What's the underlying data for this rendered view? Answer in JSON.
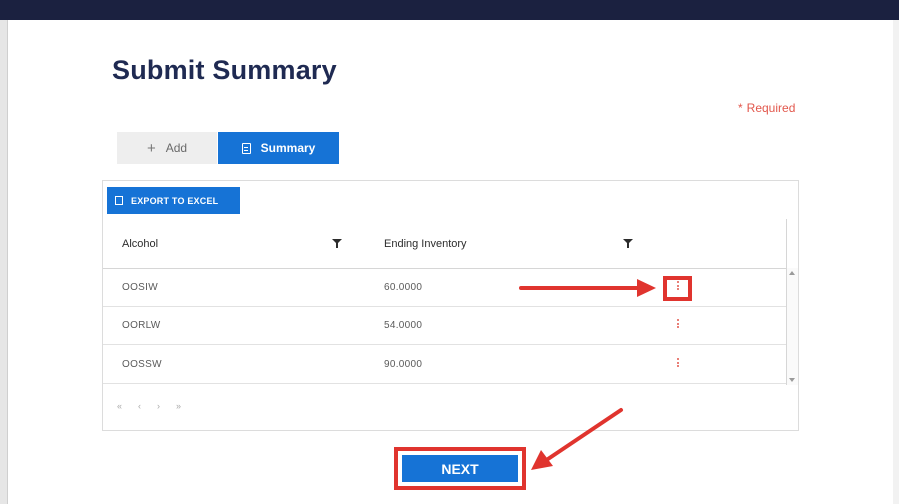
{
  "page": {
    "title": "Submit Summary",
    "required_label": "Required",
    "required_marker": "*"
  },
  "tabs": [
    {
      "label": "Add",
      "icon": "plus-icon",
      "active": false
    },
    {
      "label": "Summary",
      "icon": "document-icon",
      "active": true
    }
  ],
  "toolbar": {
    "export_label": "EXPORT TO EXCEL",
    "export_icon": "excel-icon"
  },
  "grid": {
    "columns": [
      "Alcohol",
      "Ending Inventory"
    ],
    "rows": [
      {
        "alcohol": "OOSIW",
        "ending_inventory": "60.0000"
      },
      {
        "alcohol": "OORLW",
        "ending_inventory": "54.0000"
      },
      {
        "alcohol": "OOSSW",
        "ending_inventory": "90.0000"
      }
    ]
  },
  "pager": {
    "first": "«",
    "prev": "‹",
    "next": "›",
    "last": "»"
  },
  "footer": {
    "next_label": "NEXT"
  },
  "colors": {
    "accent": "#1673d6",
    "header_bar": "#1b2140",
    "title": "#1f2a52",
    "annotation": "#e0342e",
    "required": "#e2574c"
  }
}
